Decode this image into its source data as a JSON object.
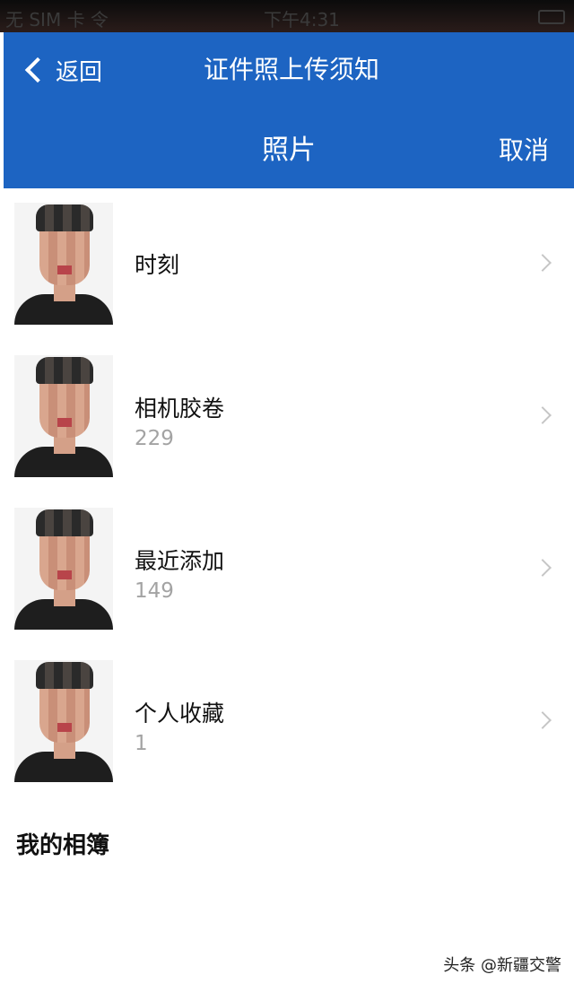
{
  "status_bar": {
    "carrier": "无 SIM 卡 令",
    "time": "下午4:31"
  },
  "nav": {
    "back_label": "返回",
    "title": "证件照上传须知"
  },
  "picker": {
    "title": "照片",
    "cancel_label": "取消"
  },
  "albums": [
    {
      "name": "时刻",
      "count": ""
    },
    {
      "name": "相机胶卷",
      "count": "229"
    },
    {
      "name": "最近添加",
      "count": "149"
    },
    {
      "name": "个人收藏",
      "count": "1"
    }
  ],
  "section_title": "我的相簿",
  "watermark": "头条 @新疆交警",
  "colors": {
    "nav_bg": "#1d64c2",
    "count_text": "#a3a3a3"
  }
}
